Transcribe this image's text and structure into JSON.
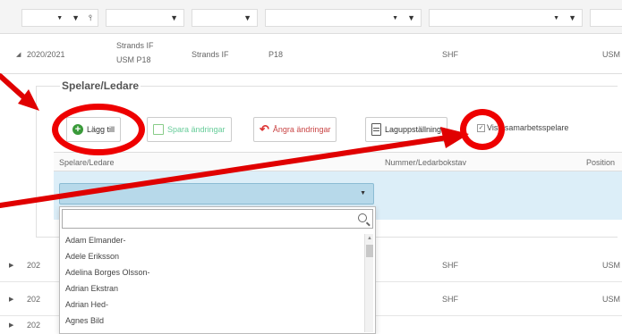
{
  "filter_row": {
    "icons": [
      "chevron-down-icon",
      "filter-icon",
      "filter-clear-icon"
    ],
    "colors": {
      "background": "#f4f4f4"
    }
  },
  "data_row": {
    "season": "2020/2021",
    "team_line1": "Strands IF",
    "team_line2": "USM P18",
    "club": "Strands IF",
    "class": "P18",
    "federation": "SHF",
    "competition": "USM"
  },
  "panel": {
    "title": "Spelare/Ledare",
    "toolbar": {
      "add_label": "Lägg till",
      "save_label": "Spara ändringar",
      "undo_label": "Ångra ändringar",
      "lineup_label": "Laguppställning",
      "show_partner_label": "Visa samarbetsspelare"
    },
    "columns": [
      "Spelare/Ledare",
      "Nummer/Ledarbokstav",
      "Position"
    ]
  },
  "dropdown": {
    "search_placeholder": "",
    "items": [
      "Adam Elmander-",
      "Adele Eriksson",
      "Adelina Borges Olsson-",
      "Adrian Ekstran",
      "Adrian Hed-",
      "Agnes Bild"
    ]
  },
  "lower_rows": [
    {
      "season": "202",
      "federation": "SHF",
      "competition": "USM"
    },
    {
      "season": "202",
      "federation": "SHF",
      "competition": "USM"
    },
    {
      "season": "202",
      "federation": "",
      "competition": ""
    }
  ],
  "annotation_color": "#e00000"
}
